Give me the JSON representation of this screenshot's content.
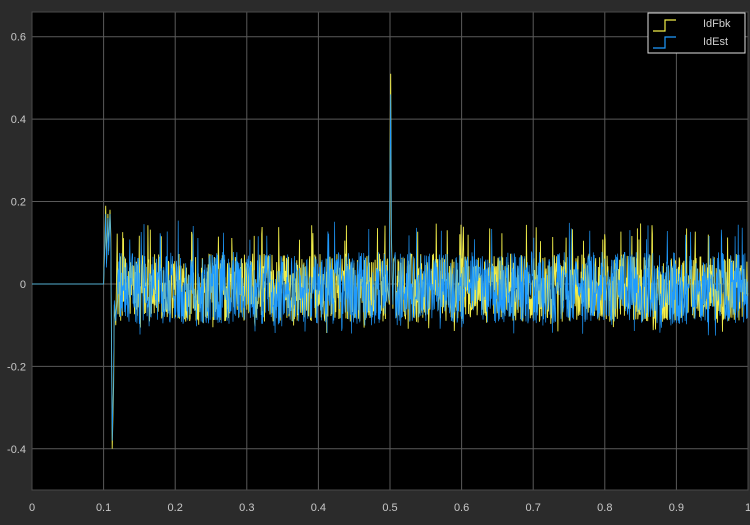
{
  "window": {
    "background": "#2b2b2b",
    "plot_background": "#000000",
    "grid_color": "#5a5a5a",
    "text_color": "#c8c8c8"
  },
  "chart_data": {
    "type": "line",
    "title": "",
    "xlabel": "",
    "ylabel": "",
    "xlim": [
      0,
      1
    ],
    "ylim": [
      -0.5,
      0.66
    ],
    "grid": true,
    "xticks": [
      0,
      0.1,
      0.2,
      0.3,
      0.4,
      0.5,
      0.6,
      0.7,
      0.8,
      0.9,
      1
    ],
    "xtick_labels": [
      "0",
      "0.1",
      "0.2",
      "0.3",
      "0.4",
      "0.5",
      "0.6",
      "0.7",
      "0.8",
      "0.9",
      "1"
    ],
    "yticks": [
      -0.4,
      -0.2,
      0,
      0.2,
      0.4,
      0.6
    ],
    "ytick_labels": [
      "-0.4",
      "-0.2",
      "0",
      "0.2",
      "0.4",
      "0.6"
    ],
    "legend": {
      "placement": "top-right",
      "entries": [
        "IdFbk",
        "IdEst"
      ]
    },
    "series": [
      {
        "name": "IdFbk",
        "color": "#f2ee4a",
        "x": [
          0,
          0.1,
          0.101,
          0.103,
          0.104,
          0.106,
          0.107,
          0.109,
          0.11,
          0.112,
          0.114,
          0.115,
          0.117,
          0.12,
          0.13,
          0.14,
          0.15,
          0.2,
          0.3,
          0.4,
          0.499,
          0.5,
          0.501,
          0.502,
          0.503,
          0.504,
          0.505,
          0.51,
          0.52,
          0.6,
          0.7,
          0.8,
          0.9,
          1.0
        ],
        "y": [
          0,
          0,
          0.06,
          0.19,
          0.05,
          0.17,
          0.08,
          0.18,
          0.12,
          -0.4,
          -0.25,
          -0.05,
          -0.1,
          -0.02,
          0.07,
          -0.07,
          0.09,
          0.05,
          0.07,
          0.06,
          -0.05,
          0.3,
          0.51,
          0.12,
          0.03,
          -0.06,
          0.06,
          -0.03,
          0.07,
          0.05,
          0.06,
          0.07,
          0.05,
          0.06
        ]
      },
      {
        "name": "IdEst",
        "color": "#1f9bff",
        "x": [
          0,
          0.1,
          0.101,
          0.103,
          0.104,
          0.106,
          0.107,
          0.109,
          0.11,
          0.112,
          0.114,
          0.115,
          0.117,
          0.12,
          0.13,
          0.14,
          0.15,
          0.2,
          0.3,
          0.4,
          0.499,
          0.5,
          0.501,
          0.502,
          0.503,
          0.504,
          0.505,
          0.51,
          0.52,
          0.6,
          0.7,
          0.8,
          0.9,
          1.0
        ],
        "y": [
          0,
          0,
          0.05,
          0.17,
          0.04,
          0.16,
          0.07,
          0.17,
          0.1,
          -0.38,
          -0.22,
          -0.04,
          -0.09,
          -0.01,
          0.08,
          -0.08,
          0.1,
          0.04,
          0.06,
          0.07,
          -0.04,
          0.28,
          0.46,
          0.1,
          0.02,
          -0.05,
          0.05,
          -0.02,
          0.08,
          0.06,
          0.05,
          0.06,
          0.06,
          0.05
        ]
      }
    ],
    "noise": {
      "from_x": 0.115,
      "to_x": 1.0,
      "band": [
        -0.1,
        0.08
      ],
      "spikes": [
        -0.13,
        0.16
      ]
    }
  }
}
